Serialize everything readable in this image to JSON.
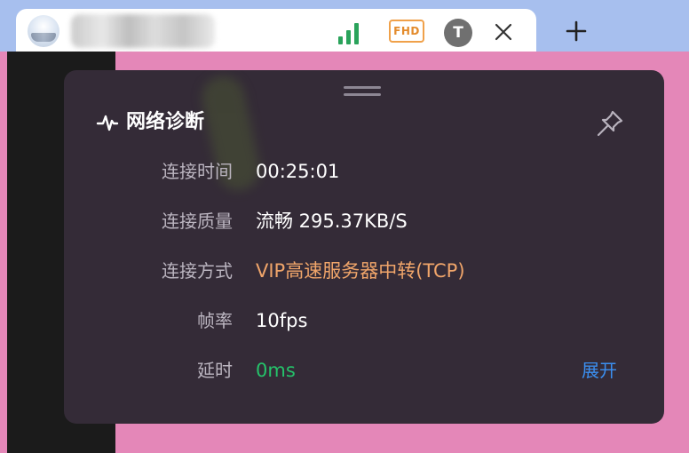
{
  "tab": {
    "fhd_badge": "FHD",
    "user_initial": "T"
  },
  "panel": {
    "title": "网络诊断",
    "rows": [
      {
        "label": "连接时间",
        "value": "00:25:01"
      },
      {
        "label": "连接质量",
        "value": "流畅 295.37KB/S"
      },
      {
        "label": "连接方式",
        "value": "VIP高速服务器中转(TCP)"
      },
      {
        "label": "帧率",
        "value": "10fps"
      },
      {
        "label": "延时",
        "value": "0ms"
      }
    ],
    "expand_link": "展开"
  },
  "colors": {
    "signal": "#2aa35b",
    "fhd": "#f0a14a",
    "connection_method": "#f0a56a",
    "latency": "#25c26a",
    "link": "#3b8ff0",
    "panel_bg": "#342b37"
  },
  "icons": {
    "signal": "signal-strength-icon",
    "close": "close-icon",
    "new_tab": "plus-icon",
    "pulse": "pulse-icon",
    "pin": "pin-icon"
  }
}
